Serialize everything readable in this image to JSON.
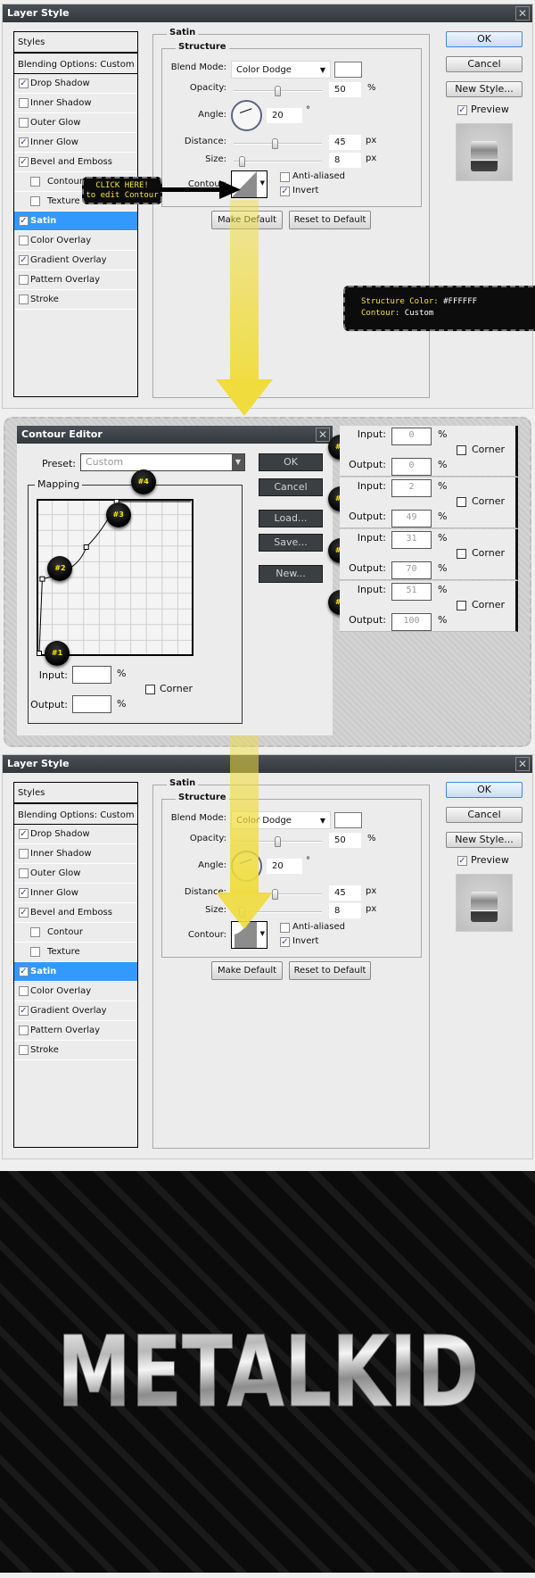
{
  "layer_style_dialogs": [
    {
      "title": "Layer Style",
      "styles_header": "Styles",
      "blending_options": "Blending Options: Custom",
      "items": [
        {
          "label": "Drop Shadow",
          "checked": true,
          "indent": false,
          "selected": false
        },
        {
          "label": "Inner Shadow",
          "checked": false,
          "indent": false,
          "selected": false
        },
        {
          "label": "Outer Glow",
          "checked": false,
          "indent": false,
          "selected": false
        },
        {
          "label": "Inner Glow",
          "checked": true,
          "indent": false,
          "selected": false
        },
        {
          "label": "Bevel and Emboss",
          "checked": true,
          "indent": false,
          "selected": false
        },
        {
          "label": "Contour",
          "checked": false,
          "indent": true,
          "selected": false
        },
        {
          "label": "Texture",
          "checked": false,
          "indent": true,
          "selected": false
        },
        {
          "label": "Satin",
          "checked": true,
          "indent": false,
          "selected": true
        },
        {
          "label": "Color Overlay",
          "checked": false,
          "indent": false,
          "selected": false
        },
        {
          "label": "Gradient Overlay",
          "checked": true,
          "indent": false,
          "selected": false
        },
        {
          "label": "Pattern Overlay",
          "checked": false,
          "indent": false,
          "selected": false
        },
        {
          "label": "Stroke",
          "checked": false,
          "indent": false,
          "selected": false
        }
      ],
      "satin": {
        "section": "Satin",
        "structure": "Structure",
        "blend_mode_label": "Blend Mode:",
        "blend_mode": "Color Dodge",
        "color": "#FFFFFF",
        "opacity_label": "Opacity:",
        "opacity": "50",
        "opacity_unit": "%",
        "angle_label": "Angle:",
        "angle": "20",
        "angle_unit": "°",
        "distance_label": "Distance:",
        "distance": "45",
        "distance_unit": "px",
        "size_label": "Size:",
        "size": "8",
        "size_unit": "px",
        "contour_label": "Contour:",
        "contour_shape": "linear",
        "anti_aliased": {
          "label": "Anti-aliased",
          "checked": false
        },
        "invert": {
          "label": "Invert",
          "checked": true
        },
        "make_default": "Make Default",
        "reset_default": "Reset to Default"
      },
      "buttons": {
        "ok": "OK",
        "cancel": "Cancel",
        "new_style": "New Style..."
      },
      "preview": {
        "label": "Preview",
        "checked": true
      }
    },
    {
      "title": "Layer Style",
      "styles_header": "Styles",
      "blending_options": "Blending Options: Custom",
      "items": [
        {
          "label": "Drop Shadow",
          "checked": true,
          "indent": false,
          "selected": false
        },
        {
          "label": "Inner Shadow",
          "checked": false,
          "indent": false,
          "selected": false
        },
        {
          "label": "Outer Glow",
          "checked": false,
          "indent": false,
          "selected": false
        },
        {
          "label": "Inner Glow",
          "checked": true,
          "indent": false,
          "selected": false
        },
        {
          "label": "Bevel and Emboss",
          "checked": true,
          "indent": false,
          "selected": false
        },
        {
          "label": "Contour",
          "checked": false,
          "indent": true,
          "selected": false
        },
        {
          "label": "Texture",
          "checked": false,
          "indent": true,
          "selected": false
        },
        {
          "label": "Satin",
          "checked": true,
          "indent": false,
          "selected": true
        },
        {
          "label": "Color Overlay",
          "checked": false,
          "indent": false,
          "selected": false
        },
        {
          "label": "Gradient Overlay",
          "checked": true,
          "indent": false,
          "selected": false
        },
        {
          "label": "Pattern Overlay",
          "checked": false,
          "indent": false,
          "selected": false
        },
        {
          "label": "Stroke",
          "checked": false,
          "indent": false,
          "selected": false
        }
      ],
      "satin": {
        "section": "Satin",
        "structure": "Structure",
        "blend_mode_label": "Blend Mode:",
        "blend_mode": "Color Dodge",
        "color": "#FFFFFF",
        "opacity_label": "Opacity:",
        "opacity": "50",
        "opacity_unit": "%",
        "angle_label": "Angle:",
        "angle": "20",
        "angle_unit": "°",
        "distance_label": "Distance:",
        "distance": "45",
        "distance_unit": "px",
        "size_label": "Size:",
        "size": "8",
        "size_unit": "px",
        "contour_label": "Contour:",
        "contour_shape": "custom",
        "anti_aliased": {
          "label": "Anti-aliased",
          "checked": false
        },
        "invert": {
          "label": "Invert",
          "checked": true
        },
        "make_default": "Make Default",
        "reset_default": "Reset to Default"
      },
      "buttons": {
        "ok": "OK",
        "cancel": "Cancel",
        "new_style": "New Style..."
      },
      "preview": {
        "label": "Preview",
        "checked": true
      }
    }
  ],
  "annotations": {
    "click_here": {
      "line1": "CLICK HERE!",
      "line2": "to edit Contour"
    },
    "structure_note": {
      "color_label": "Structure Color:",
      "color_value": "#FFFFFF",
      "contour_label": "Contour:",
      "contour_value": "Custom"
    },
    "arrow_color": "#F0DC3C"
  },
  "contour_editor": {
    "title": "Contour Editor",
    "preset_label": "Preset:",
    "preset_value": "Custom",
    "mapping_label": "Mapping",
    "input_label": "Input:",
    "output_label": "Output:",
    "unit": "%",
    "corner_label": "Corner",
    "input_value": "",
    "output_value": "",
    "buttons": [
      "OK",
      "Cancel",
      "Load...",
      "Save...",
      "New..."
    ],
    "points": [
      {
        "badge": "#1",
        "input": "0",
        "output": "0",
        "corner": false
      },
      {
        "badge": "#2",
        "input": "2",
        "output": "49",
        "corner": false
      },
      {
        "badge": "#3",
        "input": "31",
        "output": "70",
        "corner": false
      },
      {
        "badge": "#4",
        "input": "51",
        "output": "100",
        "corner": false
      }
    ]
  },
  "logo_text": "METALKID"
}
